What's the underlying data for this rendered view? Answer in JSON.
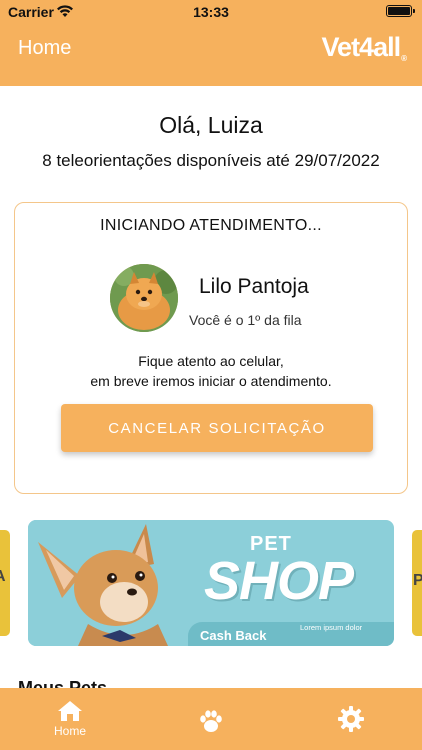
{
  "status_bar": {
    "carrier": "Carrier",
    "time": "13:33"
  },
  "header": {
    "title": "Home",
    "logo_text": "Vet4all"
  },
  "greeting": "Olá, Luiza",
  "availability": "8 teleorientações disponíveis até 29/07/2022",
  "attendance_card": {
    "heading": "INICIANDO ATENDIMENTO...",
    "pet_name": "Lilo Pantoja",
    "queue_position": "Você é o 1º da fila",
    "message_line1": "Fique atento ao celular,",
    "message_line2": "em breve iremos iniciar o atendimento.",
    "cancel_label": "CANCELAR SOLICITAÇÃO"
  },
  "banner": {
    "pet": "PET",
    "shop": "SHOP",
    "cashback": "Cash Back",
    "lorem": "Lorem ipsum dolor"
  },
  "section_partial_title": "Meus Pets",
  "tabbar": {
    "items": [
      {
        "label": "Home",
        "icon": "home-icon",
        "active": true
      },
      {
        "label": "",
        "icon": "paw-icon",
        "active": false
      },
      {
        "label": "",
        "icon": "gear-icon",
        "active": false
      }
    ]
  },
  "colors": {
    "accent": "#f6b15d",
    "card_border": "#f4c68a",
    "banner_bg": "#8ccfd9"
  }
}
